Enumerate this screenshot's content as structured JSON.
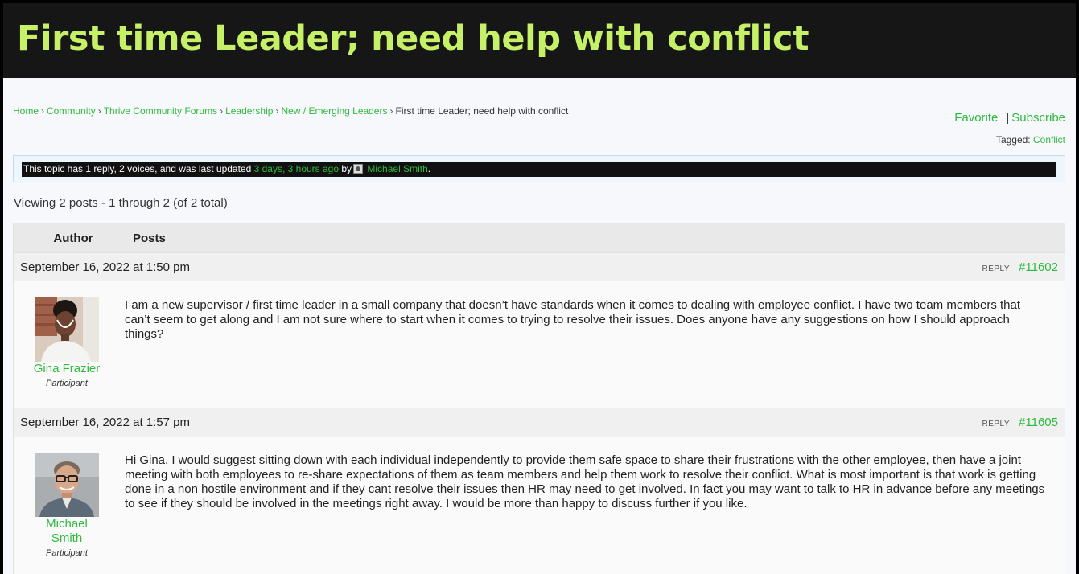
{
  "page": {
    "title": "First time Leader; need help with conflict"
  },
  "breadcrumb": {
    "items": [
      "Home",
      "Community",
      "Thrive Community Forums",
      "Leadership",
      "New / Emerging Leaders"
    ],
    "current": "First time Leader; need help with conflict",
    "separator": "›"
  },
  "actions": {
    "favorite": "Favorite",
    "pipe": "|",
    "subscribe": "Subscribe"
  },
  "tags": {
    "label": "Tagged:",
    "items": [
      "Conflict"
    ]
  },
  "topic_info": {
    "prefix": "This topic has 1 reply, 2 voices, and was last updated",
    "freshness": "3 days, 3 hours ago",
    "by": "by",
    "last_author": "Michael Smith",
    "period": "."
  },
  "viewing": "Viewing 2 posts - 1 through 2 (of 2 total)",
  "table_head": {
    "author": "Author",
    "posts": "Posts"
  },
  "posts": [
    {
      "date": "September 16, 2022 at 1:50 pm",
      "reply_label": "REPLY",
      "id": "#11602",
      "author": "Gina Frazier",
      "role": "Participant",
      "content": "I am a new supervisor / first time leader in a small company that doesn’t have standards when it comes to dealing with employee conflict. I have two team members that can’t seem to get along and I am not sure where to start when it comes to trying to resolve their issues. Does anyone have any suggestions on how I should approach things?"
    },
    {
      "date": "September 16, 2022 at 1:57 pm",
      "reply_label": "REPLY",
      "id": "#11605",
      "author": "Michael Smith",
      "role": "Participant",
      "content": "Hi Gina, I would suggest sitting down with each individual independently to provide them safe space to share their frustrations with the other employee, then have a joint meeting with both employees to re-share expectations of them as team members and help them work to resolve their conflict. What is most important is that work is getting done in a non hostile environment and if they cant resolve their issues then HR may need to get involved. In fact you may want to talk to HR in advance before any meetings to see if they should be involved in the meetings right away. I would be more than happy to discuss further if you like."
    }
  ],
  "colors": {
    "header_bg": "#161616",
    "title": "#c6f068",
    "link": "#2fba3e"
  }
}
